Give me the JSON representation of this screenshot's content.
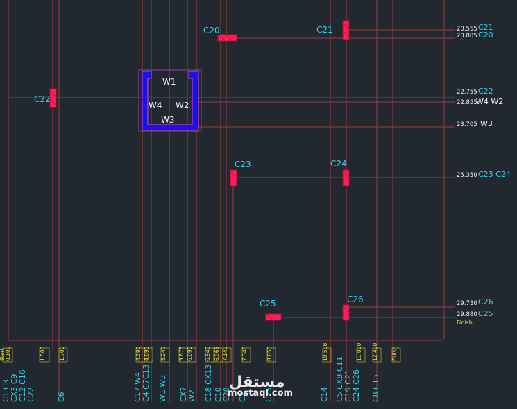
{
  "colors": {
    "background": "#212830",
    "grid_line": "#9a3b3b",
    "element_fill": "#ff1e5a",
    "wall_fill": "#1414e6",
    "wall_outline": "#c23cd0",
    "label_cyan": "#36d0e6",
    "label_white": "#f2f2f2",
    "label_yellow": "#f6e63a"
  },
  "elements": [
    {
      "id": "c20",
      "label": "C20",
      "kind": "horizontal"
    },
    {
      "id": "c21",
      "label": "C21",
      "kind": "vertical"
    },
    {
      "id": "c22",
      "label": "C22",
      "kind": "vertical"
    },
    {
      "id": "c23",
      "label": "C23",
      "kind": "vertical"
    },
    {
      "id": "c24",
      "label": "C24",
      "kind": "vertical"
    },
    {
      "id": "c25",
      "label": "C25",
      "kind": "horizontal"
    },
    {
      "id": "c26",
      "label": "C26",
      "kind": "vertical"
    }
  ],
  "walls": [
    {
      "id": "w1",
      "label": "W1"
    },
    {
      "id": "w2",
      "label": "W2"
    },
    {
      "id": "w3",
      "label": "W3"
    },
    {
      "id": "w4",
      "label": "W4"
    }
  ],
  "levels": [
    {
      "value": "20.555",
      "label": "C21"
    },
    {
      "value": "20.805",
      "label": "C20"
    },
    {
      "value": "22.755",
      "label": "C22"
    },
    {
      "value": "22.855",
      "label": "W4 W2"
    },
    {
      "value": "23.705",
      "label": "W3"
    },
    {
      "value": "25.350",
      "label": "C23 C24"
    },
    {
      "value": "29.730",
      "label": "C26"
    },
    {
      "value": "29.880",
      "label": "C25"
    },
    {
      "value": "",
      "label": "Finish"
    }
  ],
  "axis_stations": [
    {
      "value": "Start\n0.100",
      "labels": [
        "C1 C3",
        "CX3 C9",
        "C12 C16",
        "C22"
      ]
    },
    {
      "value": "1.500",
      "labels": []
    },
    {
      "value": "1.700",
      "labels": [
        "C6"
      ]
    },
    {
      "value": "4.390",
      "labels": [
        "C17 W4"
      ]
    },
    {
      "value": "4.695",
      "labels": [
        "C4 C7C13"
      ]
    },
    {
      "value": "5.240",
      "labels": [
        "W1 W3"
      ]
    },
    {
      "value": "5.875",
      "labels": [
        "CX7"
      ]
    },
    {
      "value": "6.090",
      "labels": [
        "W2"
      ]
    },
    {
      "value": "6.940",
      "labels": [
        "C18 CX13"
      ]
    },
    {
      "value": "6.965",
      "labels": [
        "C10"
      ]
    },
    {
      "value": "7.140",
      "labels": [
        "C20"
      ]
    },
    {
      "value": "7.340",
      "labels": [
        "C2"
      ]
    },
    {
      "value": "8.650",
      "labels": [
        "C25"
      ]
    },
    {
      "value": "10.508",
      "labels": [
        "C14"
      ]
    },
    {
      "value": "11.000",
      "labels": [
        "C5 CX8 C11",
        "C19 C21",
        "C24 C26"
      ]
    },
    {
      "value": "12.400",
      "labels": [
        "C8 C15"
      ]
    },
    {
      "value": "Finish",
      "labels": []
    }
  ],
  "watermark": {
    "arabic": "مستقل",
    "latin": "mostaql.com"
  }
}
